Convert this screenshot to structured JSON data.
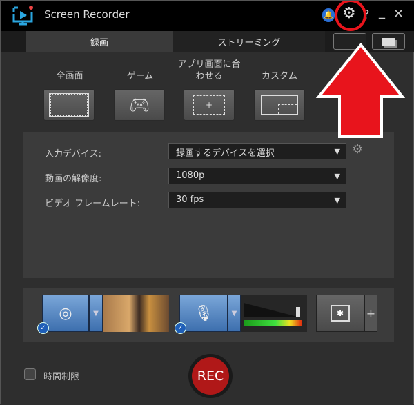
{
  "app": {
    "title": "Screen Recorder"
  },
  "tabs": [
    {
      "label": "録画"
    },
    {
      "label": "ストリーミング"
    }
  ],
  "modes": [
    {
      "label": "全画面"
    },
    {
      "label": "ゲーム"
    },
    {
      "label": "アプリ画面に合わせる"
    },
    {
      "label": "カスタム"
    }
  ],
  "settings": {
    "input_device": {
      "label": "入力デバイス:",
      "value": "録画するデバイスを選択"
    },
    "resolution": {
      "label": "動画の解像度:",
      "value": "1080p"
    },
    "framerate": {
      "label": "ビデオ フレームレート:",
      "value": "30 fps"
    }
  },
  "bottom": {
    "time_limit_label": "時間制限",
    "rec_label": "REC"
  },
  "colors": {
    "accent": "#e8141c",
    "rec": "#b01818"
  }
}
